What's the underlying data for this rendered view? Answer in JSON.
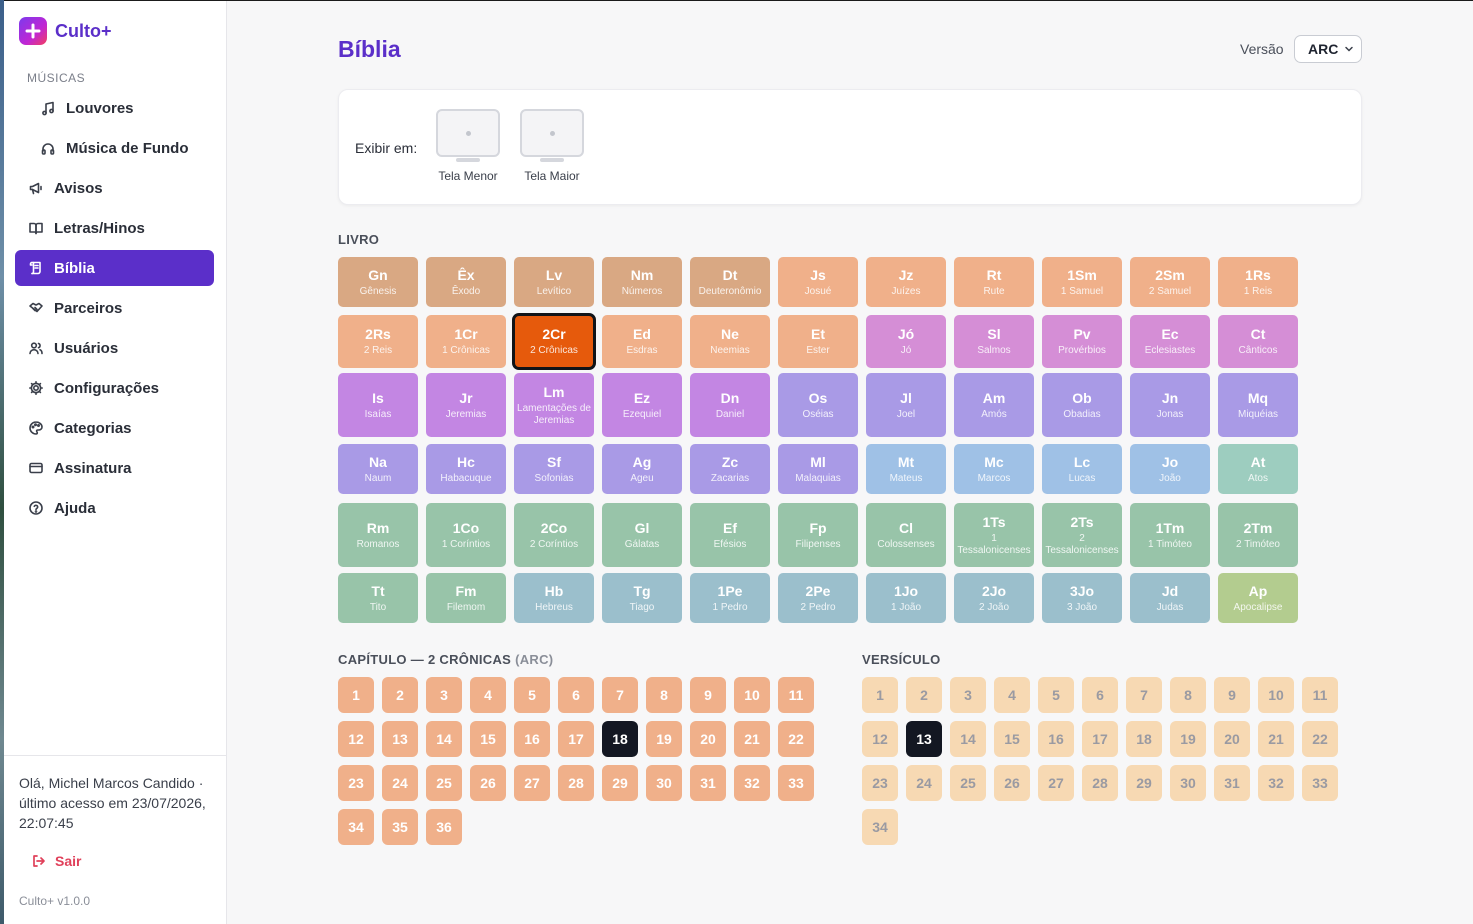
{
  "app": {
    "name": "Culto+",
    "version": "Culto+ v1.0.0"
  },
  "sidebar": {
    "section_musicas": "MÚSICAS",
    "items": [
      {
        "key": "louvores",
        "label": "Louvores",
        "icon": "music-note-icon",
        "sub": true
      },
      {
        "key": "musica-fundo",
        "label": "Música de Fundo",
        "icon": "headphones-icon",
        "sub": true
      },
      {
        "key": "avisos",
        "label": "Avisos",
        "icon": "megaphone-icon"
      },
      {
        "key": "letras",
        "label": "Letras/Hinos",
        "icon": "book-open-icon"
      },
      {
        "key": "biblia",
        "label": "Bíblia",
        "icon": "scroll-icon",
        "active": true
      },
      {
        "key": "parceiros",
        "label": "Parceiros",
        "icon": "handshake-icon"
      },
      {
        "key": "usuarios",
        "label": "Usuários",
        "icon": "users-icon"
      },
      {
        "key": "configuracoes",
        "label": "Configurações",
        "icon": "gear-icon"
      },
      {
        "key": "categorias",
        "label": "Categorias",
        "icon": "palette-icon"
      },
      {
        "key": "assinatura",
        "label": "Assinatura",
        "icon": "credit-card-icon"
      },
      {
        "key": "ajuda",
        "label": "Ajuda",
        "icon": "help-circle-icon"
      }
    ],
    "greeting": "Olá, Michel Marcos Candido · último acesso em 23/07/2026, 22:07:45",
    "logout": "Sair"
  },
  "header": {
    "title": "Bíblia",
    "version_label": "Versão",
    "version_value": "ARC"
  },
  "display": {
    "label": "Exibir em:",
    "options": [
      {
        "label": "Tela Menor"
      },
      {
        "label": "Tela Maior"
      }
    ]
  },
  "books": {
    "label": "LIVRO",
    "selected": "2Cr",
    "items": [
      {
        "abbr": "Gn",
        "name": "Gênesis",
        "color": "#d9a883"
      },
      {
        "abbr": "Êx",
        "name": "Êxodo",
        "color": "#d9a883"
      },
      {
        "abbr": "Lv",
        "name": "Levítico",
        "color": "#d9a883"
      },
      {
        "abbr": "Nm",
        "name": "Números",
        "color": "#d9a883"
      },
      {
        "abbr": "Dt",
        "name": "Deuteronômio",
        "color": "#d9a883"
      },
      {
        "abbr": "Js",
        "name": "Josué",
        "color": "#f0b08a"
      },
      {
        "abbr": "Jz",
        "name": "Juízes",
        "color": "#f0b08a"
      },
      {
        "abbr": "Rt",
        "name": "Rute",
        "color": "#f0b08a"
      },
      {
        "abbr": "1Sm",
        "name": "1 Samuel",
        "color": "#f0b08a"
      },
      {
        "abbr": "2Sm",
        "name": "2 Samuel",
        "color": "#f0b08a"
      },
      {
        "abbr": "1Rs",
        "name": "1 Reis",
        "color": "#f0b08a"
      },
      {
        "abbr": "2Rs",
        "name": "2 Reis",
        "color": "#f0b08a"
      },
      {
        "abbr": "1Cr",
        "name": "1 Crônicas",
        "color": "#f0b08a"
      },
      {
        "abbr": "2Cr",
        "name": "2 Crônicas",
        "color": "#e65a0c"
      },
      {
        "abbr": "Ed",
        "name": "Esdras",
        "color": "#f0b08a"
      },
      {
        "abbr": "Ne",
        "name": "Neemias",
        "color": "#f0b08a"
      },
      {
        "abbr": "Et",
        "name": "Ester",
        "color": "#f0b08a"
      },
      {
        "abbr": "Jó",
        "name": "Jó",
        "color": "#d58ed6"
      },
      {
        "abbr": "Sl",
        "name": "Salmos",
        "color": "#d58ed6"
      },
      {
        "abbr": "Pv",
        "name": "Provérbios",
        "color": "#d58ed6"
      },
      {
        "abbr": "Ec",
        "name": "Eclesiastes",
        "color": "#d58ed6"
      },
      {
        "abbr": "Ct",
        "name": "Cânticos",
        "color": "#d58ed6"
      },
      {
        "abbr": "Is",
        "name": "Isaías",
        "color": "#c386e3"
      },
      {
        "abbr": "Jr",
        "name": "Jeremias",
        "color": "#c386e3"
      },
      {
        "abbr": "Lm",
        "name": "Lamentações de Jeremias",
        "color": "#c386e3"
      },
      {
        "abbr": "Ez",
        "name": "Ezequiel",
        "color": "#c386e3"
      },
      {
        "abbr": "Dn",
        "name": "Daniel",
        "color": "#c386e3"
      },
      {
        "abbr": "Os",
        "name": "Oséias",
        "color": "#a99ae6"
      },
      {
        "abbr": "Jl",
        "name": "Joel",
        "color": "#a99ae6"
      },
      {
        "abbr": "Am",
        "name": "Amós",
        "color": "#a99ae6"
      },
      {
        "abbr": "Ob",
        "name": "Obadias",
        "color": "#a99ae6"
      },
      {
        "abbr": "Jn",
        "name": "Jonas",
        "color": "#a99ae6"
      },
      {
        "abbr": "Mq",
        "name": "Miquéias",
        "color": "#a99ae6"
      },
      {
        "abbr": "Na",
        "name": "Naum",
        "color": "#a99ae6"
      },
      {
        "abbr": "Hc",
        "name": "Habacuque",
        "color": "#a99ae6"
      },
      {
        "abbr": "Sf",
        "name": "Sofonias",
        "color": "#a99ae6"
      },
      {
        "abbr": "Ag",
        "name": "Ageu",
        "color": "#a99ae6"
      },
      {
        "abbr": "Zc",
        "name": "Zacarias",
        "color": "#a99ae6"
      },
      {
        "abbr": "Ml",
        "name": "Malaquias",
        "color": "#a99ae6"
      },
      {
        "abbr": "Mt",
        "name": "Mateus",
        "color": "#9fc1e6"
      },
      {
        "abbr": "Mc",
        "name": "Marcos",
        "color": "#9fc1e6"
      },
      {
        "abbr": "Lc",
        "name": "Lucas",
        "color": "#9fc1e6"
      },
      {
        "abbr": "Jo",
        "name": "João",
        "color": "#9fc1e6"
      },
      {
        "abbr": "At",
        "name": "Atos",
        "color": "#9dcdbf"
      },
      {
        "abbr": "Rm",
        "name": "Romanos",
        "color": "#98c4a9"
      },
      {
        "abbr": "1Co",
        "name": "1 Coríntios",
        "color": "#98c4a9"
      },
      {
        "abbr": "2Co",
        "name": "2 Coríntios",
        "color": "#98c4a9"
      },
      {
        "abbr": "Gl",
        "name": "Gálatas",
        "color": "#98c4a9"
      },
      {
        "abbr": "Ef",
        "name": "Efésios",
        "color": "#98c4a9"
      },
      {
        "abbr": "Fp",
        "name": "Filipenses",
        "color": "#98c4a9"
      },
      {
        "abbr": "Cl",
        "name": "Colossenses",
        "color": "#98c4a9"
      },
      {
        "abbr": "1Ts",
        "name": "1 Tessalonicenses",
        "color": "#98c4a9"
      },
      {
        "abbr": "2Ts",
        "name": "2 Tessalonicenses",
        "color": "#98c4a9"
      },
      {
        "abbr": "1Tm",
        "name": "1 Timóteo",
        "color": "#98c4a9"
      },
      {
        "abbr": "2Tm",
        "name": "2 Timóteo",
        "color": "#98c4a9"
      },
      {
        "abbr": "Tt",
        "name": "Tito",
        "color": "#98c4a9"
      },
      {
        "abbr": "Fm",
        "name": "Filemom",
        "color": "#98c4a9"
      },
      {
        "abbr": "Hb",
        "name": "Hebreus",
        "color": "#9bbfcc"
      },
      {
        "abbr": "Tg",
        "name": "Tiago",
        "color": "#9bbfcc"
      },
      {
        "abbr": "1Pe",
        "name": "1 Pedro",
        "color": "#9bbfcc"
      },
      {
        "abbr": "2Pe",
        "name": "2 Pedro",
        "color": "#9bbfcc"
      },
      {
        "abbr": "1Jo",
        "name": "1 João",
        "color": "#9bbfcc"
      },
      {
        "abbr": "2Jo",
        "name": "2 João",
        "color": "#9bbfcc"
      },
      {
        "abbr": "3Jo",
        "name": "3 João",
        "color": "#9bbfcc"
      },
      {
        "abbr": "Jd",
        "name": "Judas",
        "color": "#9bbfcc"
      },
      {
        "abbr": "Ap",
        "name": "Apocalipse",
        "color": "#b3cc8f"
      }
    ]
  },
  "chapters": {
    "label": "CAPÍTULO — 2 CRÔNICAS",
    "label_version": "(ARC)",
    "count": 36,
    "selected": 18
  },
  "verses": {
    "label": "VERSÍCULO",
    "count": 34,
    "selected": 13
  }
}
